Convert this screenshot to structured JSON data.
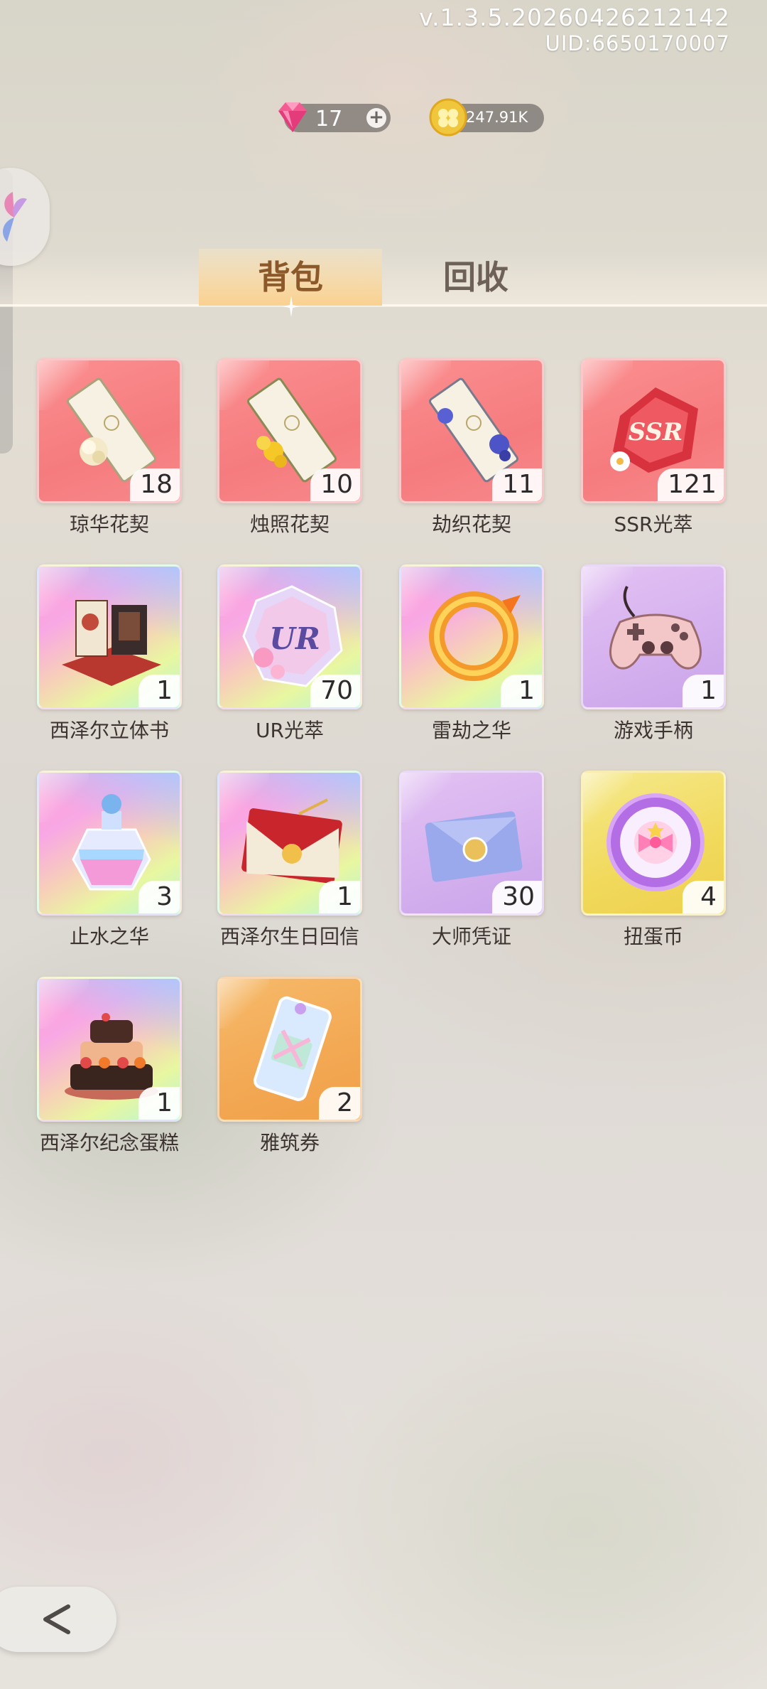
{
  "version": {
    "build": "v.1.3.5.20260426212142",
    "uid": "UID:6650170007"
  },
  "currency": {
    "gems": "17",
    "gem_icon": "pink-gem-icon",
    "coins": "247.91K",
    "coin_icon": "gold-clover-coin-icon"
  },
  "tabs": [
    {
      "label": "背包",
      "active": true
    },
    {
      "label": "回收",
      "active": false
    }
  ],
  "items": [
    {
      "name": "琼华花契",
      "count": "18",
      "bg": "red",
      "icon": "white-flower-ticket-icon"
    },
    {
      "name": "烛照花契",
      "count": "10",
      "bg": "red",
      "icon": "yellow-flower-ticket-icon"
    },
    {
      "name": "劫织花契",
      "count": "11",
      "bg": "red",
      "icon": "blue-flower-ticket-icon"
    },
    {
      "name": "SSR光萃",
      "count": "121",
      "bg": "red",
      "icon": "ssr-gem-icon"
    },
    {
      "name": "西泽尔立体书",
      "count": "1",
      "bg": "rainbow",
      "icon": "pop-up-book-icon"
    },
    {
      "name": "UR光萃",
      "count": "70",
      "bg": "rainbow",
      "icon": "ur-crystal-icon"
    },
    {
      "name": "雷劫之华",
      "count": "1",
      "bg": "rainbow",
      "icon": "fire-dragon-ring-icon"
    },
    {
      "name": "游戏手柄",
      "count": "1",
      "bg": "purple",
      "icon": "game-controller-icon"
    },
    {
      "name": "止水之华",
      "count": "3",
      "bg": "rainbow",
      "icon": "perfume-bottle-icon"
    },
    {
      "name": "西泽尔生日回信",
      "count": "1",
      "bg": "rainbow",
      "icon": "red-envelope-letter-icon"
    },
    {
      "name": "大师凭证",
      "count": "30",
      "bg": "purple",
      "icon": "blue-envelope-icon"
    },
    {
      "name": "扭蛋币",
      "count": "4",
      "bg": "yellow",
      "icon": "gacha-coin-icon"
    },
    {
      "name": "西泽尔纪念蛋糕",
      "count": "1",
      "bg": "rainbow",
      "icon": "layered-cake-icon"
    },
    {
      "name": "雅筑券",
      "count": "2",
      "bg": "orange",
      "icon": "gift-ticket-icon"
    }
  ]
}
